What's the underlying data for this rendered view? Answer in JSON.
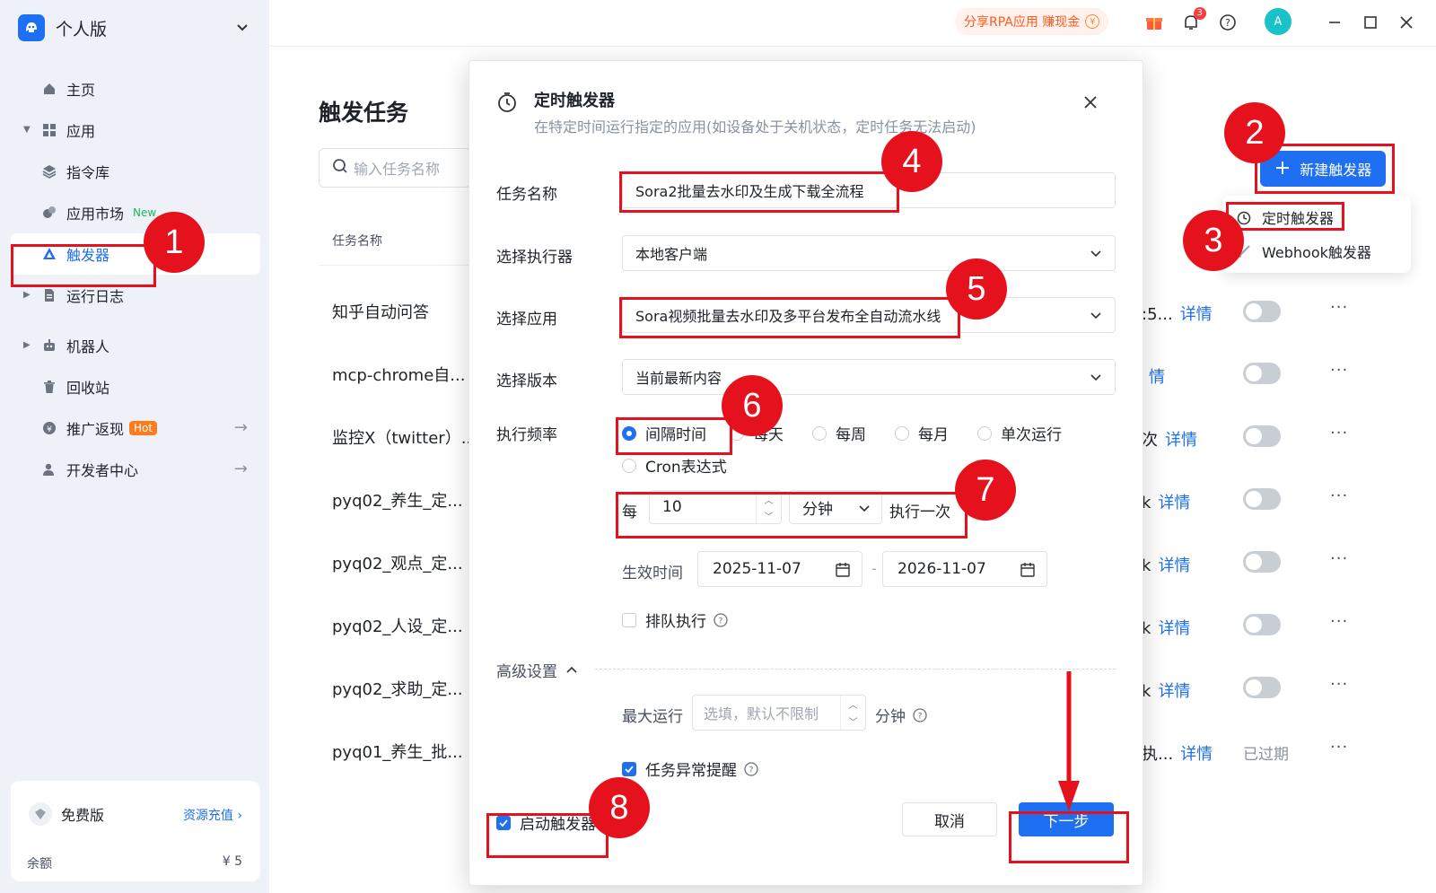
{
  "brand": {
    "name": "个人版"
  },
  "sidebar": {
    "items": [
      {
        "label": "主页"
      },
      {
        "label": "应用"
      },
      {
        "label": "指令库"
      },
      {
        "label": "应用市场",
        "badge": "New"
      },
      {
        "label": "触发器"
      },
      {
        "label": "运行日志"
      },
      {
        "label": "机器人"
      },
      {
        "label": "回收站"
      },
      {
        "label": "推广返现",
        "badge": "Hot"
      },
      {
        "label": "开发者中心"
      }
    ],
    "plan": {
      "name": "免费版",
      "link": "资源充值 ›",
      "balance_label": "余额",
      "balance_value": "¥ 5"
    }
  },
  "topbar": {
    "promo": "分享RPA应用 赚现金",
    "coin": "¥",
    "notifications": "3",
    "avatar": "A"
  },
  "page": {
    "title": "触发任务",
    "search_placeholder": "输入任务名称",
    "column_task_name": "任务名称",
    "new_button": "新建触发器",
    "dropdown": {
      "timer": "定时触发器",
      "webhook": "Webhook触发器"
    },
    "rows": [
      {
        "name": "知乎自动问答",
        "tail": ":5...",
        "detail": "详情"
      },
      {
        "name": "mcp-chrome自...",
        "tail": "",
        "detail": "情"
      },
      {
        "name": "监控X（twitter）...",
        "tail": "次",
        "detail": "详情"
      },
      {
        "name": "pyq02_养生_定...",
        "tail": "k",
        "detail": "详情"
      },
      {
        "name": "pyq02_观点_定...",
        "tail": "k",
        "detail": "详情"
      },
      {
        "name": "pyq02_人设_定...",
        "tail": "k",
        "detail": "详情"
      },
      {
        "name": "pyq02_求助_定...",
        "tail": "k",
        "detail": "详情"
      },
      {
        "name": "pyq01_养生_批...",
        "tail": "执...",
        "detail": "详情",
        "status": "已过期"
      }
    ]
  },
  "modal": {
    "title": "定时触发器",
    "subtitle": "在特定时间运行指定的应用(如设备处于关机状态，定时任务无法启动)",
    "task_name_label": "任务名称",
    "task_name_value": "Sora2批量去水印及生成下载全流程",
    "executor_label": "选择执行器",
    "executor_value": "本地客户端",
    "app_label": "选择应用",
    "app_value": "Sora视频批量去水印及多平台发布全自动流水线",
    "version_label": "选择版本",
    "version_value": "当前最新内容",
    "freq_label": "执行频率",
    "freq_options": [
      "间隔时间",
      "每天",
      "每周",
      "每月",
      "单次运行",
      "Cron表达式"
    ],
    "every_prefix": "每",
    "interval_value": "10",
    "interval_unit": "分钟",
    "every_suffix": "执行一次",
    "effective_label": "生效时间",
    "start_date": "2025-11-07",
    "date_separator": "-",
    "end_date": "2026-11-07",
    "queue_label": "排队执行",
    "advanced_label": "高级设置",
    "max_run_label": "最大运行",
    "max_run_placeholder": "选填，默认不限制",
    "max_run_unit": "分钟",
    "alert_label": "任务异常提醒",
    "enable_label": "启动触发器",
    "cancel": "取消",
    "next": "下一步"
  },
  "annotations": [
    "1",
    "2",
    "3",
    "4",
    "5",
    "6",
    "7",
    "8"
  ],
  "colors": {
    "accent": "#1e6ff1",
    "annotation": "#e5121d",
    "sidebar_bg": "#eef2f8"
  }
}
